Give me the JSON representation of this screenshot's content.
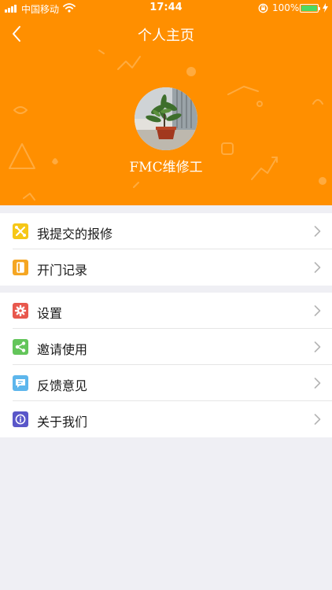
{
  "status_bar": {
    "carrier": "中国移动",
    "time": "17:44",
    "battery_percent": "100%"
  },
  "header": {
    "title": "个人主页",
    "username": "FMC维修工",
    "background_color": "#ff8f00"
  },
  "menu_group_1": [
    {
      "label": "我提交的报修",
      "icon": "wrench-icon",
      "icon_color": "#f6c717"
    },
    {
      "label": "开门记录",
      "icon": "door-icon",
      "icon_color": "#f5a623"
    }
  ],
  "menu_group_2": [
    {
      "label": "设置",
      "icon": "gear-icon",
      "icon_color": "#e8584d"
    },
    {
      "label": "邀请使用",
      "icon": "share-icon",
      "icon_color": "#63c55a"
    },
    {
      "label": "反馈意见",
      "icon": "chat-icon",
      "icon_color": "#5db6ec"
    },
    {
      "label": "关于我们",
      "icon": "info-icon",
      "icon_color": "#5a57c9"
    }
  ]
}
